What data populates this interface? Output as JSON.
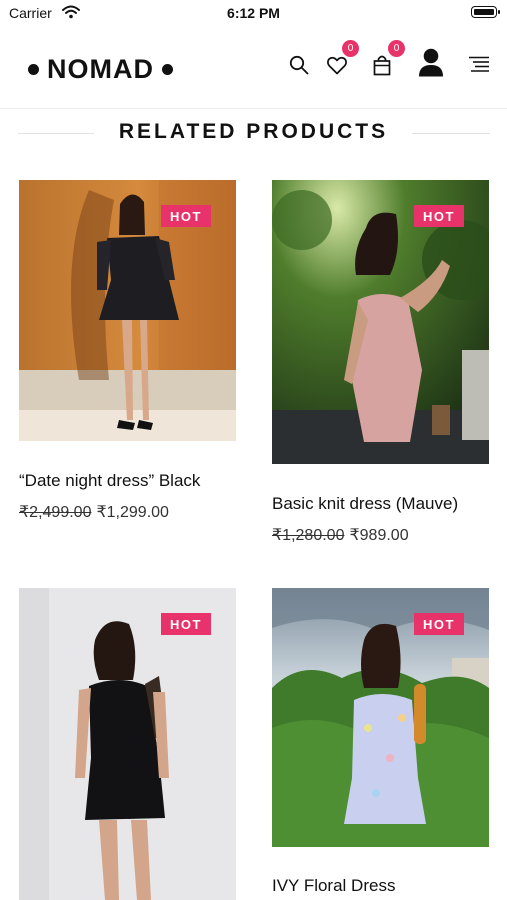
{
  "status_bar": {
    "carrier": "Carrier",
    "time": "6:12 PM"
  },
  "header": {
    "logo": "NOMAD",
    "wishlist_count": "0",
    "cart_count": "0"
  },
  "section": {
    "title": "RELATED PRODUCTS"
  },
  "products": [
    {
      "badge": "HOT",
      "name": "“Date night dress” Black",
      "old_price": "₹2,499.00",
      "price": "₹1,299.00"
    },
    {
      "badge": "HOT",
      "name": "Basic knit dress (Mauve)",
      "old_price": "₹1,280.00",
      "price": "₹989.00"
    },
    {
      "badge": "HOT",
      "name": "",
      "old_price": "",
      "price": ""
    },
    {
      "badge": "HOT",
      "name": "IVY Floral Dress",
      "old_price": "",
      "price": ""
    }
  ],
  "icons": [
    "wifi-icon",
    "battery-icon",
    "search-icon",
    "heart-icon",
    "shopping-bag-icon",
    "user-icon",
    "menu-icon"
  ],
  "colors": {
    "accent": "#e8336a",
    "text": "#111111",
    "divider": "#e2e2e2"
  }
}
